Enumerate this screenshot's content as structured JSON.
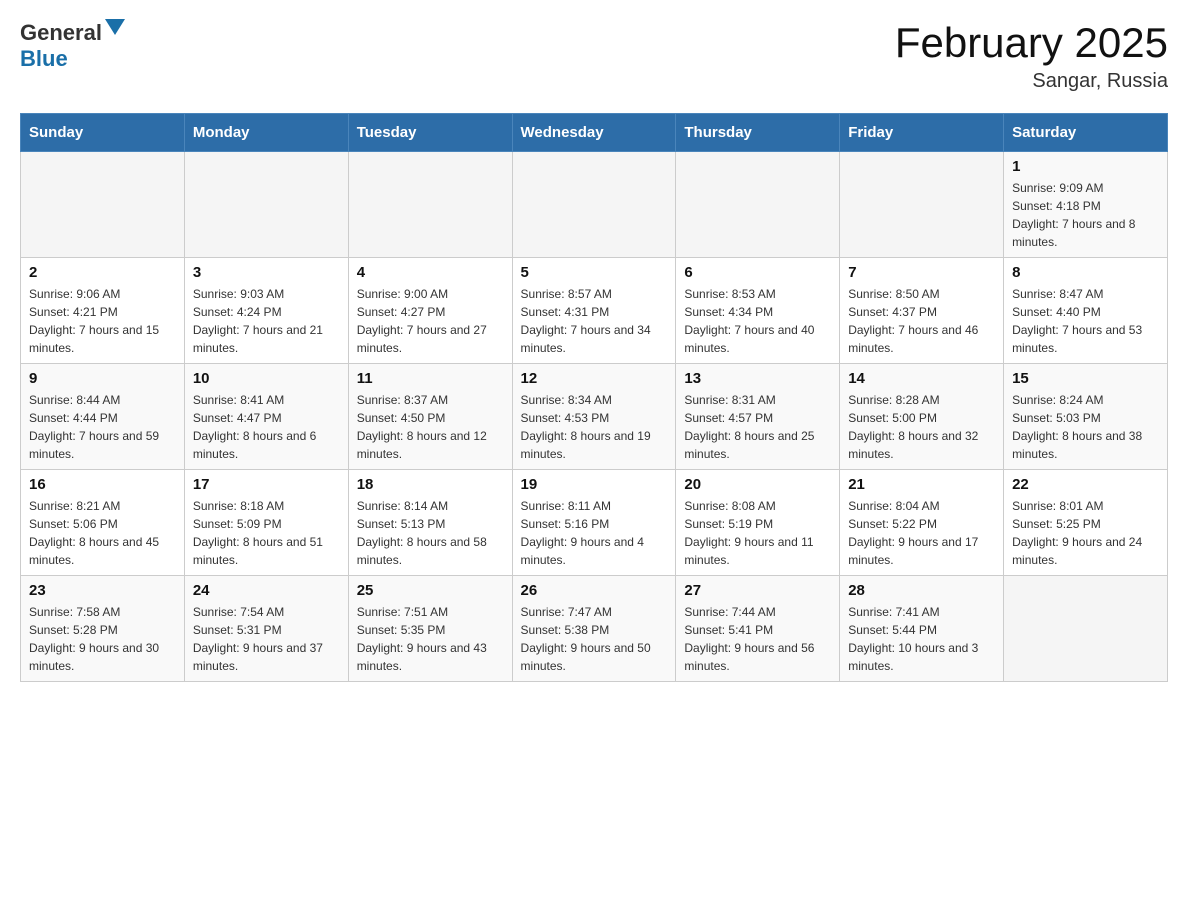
{
  "header": {
    "logo_general": "General",
    "logo_blue": "Blue",
    "title": "February 2025",
    "subtitle": "Sangar, Russia"
  },
  "weekdays": [
    "Sunday",
    "Monday",
    "Tuesday",
    "Wednesday",
    "Thursday",
    "Friday",
    "Saturday"
  ],
  "weeks": [
    [
      {
        "day": "",
        "info": ""
      },
      {
        "day": "",
        "info": ""
      },
      {
        "day": "",
        "info": ""
      },
      {
        "day": "",
        "info": ""
      },
      {
        "day": "",
        "info": ""
      },
      {
        "day": "",
        "info": ""
      },
      {
        "day": "1",
        "info": "Sunrise: 9:09 AM\nSunset: 4:18 PM\nDaylight: 7 hours and 8 minutes."
      }
    ],
    [
      {
        "day": "2",
        "info": "Sunrise: 9:06 AM\nSunset: 4:21 PM\nDaylight: 7 hours and 15 minutes."
      },
      {
        "day": "3",
        "info": "Sunrise: 9:03 AM\nSunset: 4:24 PM\nDaylight: 7 hours and 21 minutes."
      },
      {
        "day": "4",
        "info": "Sunrise: 9:00 AM\nSunset: 4:27 PM\nDaylight: 7 hours and 27 minutes."
      },
      {
        "day": "5",
        "info": "Sunrise: 8:57 AM\nSunset: 4:31 PM\nDaylight: 7 hours and 34 minutes."
      },
      {
        "day": "6",
        "info": "Sunrise: 8:53 AM\nSunset: 4:34 PM\nDaylight: 7 hours and 40 minutes."
      },
      {
        "day": "7",
        "info": "Sunrise: 8:50 AM\nSunset: 4:37 PM\nDaylight: 7 hours and 46 minutes."
      },
      {
        "day": "8",
        "info": "Sunrise: 8:47 AM\nSunset: 4:40 PM\nDaylight: 7 hours and 53 minutes."
      }
    ],
    [
      {
        "day": "9",
        "info": "Sunrise: 8:44 AM\nSunset: 4:44 PM\nDaylight: 7 hours and 59 minutes."
      },
      {
        "day": "10",
        "info": "Sunrise: 8:41 AM\nSunset: 4:47 PM\nDaylight: 8 hours and 6 minutes."
      },
      {
        "day": "11",
        "info": "Sunrise: 8:37 AM\nSunset: 4:50 PM\nDaylight: 8 hours and 12 minutes."
      },
      {
        "day": "12",
        "info": "Sunrise: 8:34 AM\nSunset: 4:53 PM\nDaylight: 8 hours and 19 minutes."
      },
      {
        "day": "13",
        "info": "Sunrise: 8:31 AM\nSunset: 4:57 PM\nDaylight: 8 hours and 25 minutes."
      },
      {
        "day": "14",
        "info": "Sunrise: 8:28 AM\nSunset: 5:00 PM\nDaylight: 8 hours and 32 minutes."
      },
      {
        "day": "15",
        "info": "Sunrise: 8:24 AM\nSunset: 5:03 PM\nDaylight: 8 hours and 38 minutes."
      }
    ],
    [
      {
        "day": "16",
        "info": "Sunrise: 8:21 AM\nSunset: 5:06 PM\nDaylight: 8 hours and 45 minutes."
      },
      {
        "day": "17",
        "info": "Sunrise: 8:18 AM\nSunset: 5:09 PM\nDaylight: 8 hours and 51 minutes."
      },
      {
        "day": "18",
        "info": "Sunrise: 8:14 AM\nSunset: 5:13 PM\nDaylight: 8 hours and 58 minutes."
      },
      {
        "day": "19",
        "info": "Sunrise: 8:11 AM\nSunset: 5:16 PM\nDaylight: 9 hours and 4 minutes."
      },
      {
        "day": "20",
        "info": "Sunrise: 8:08 AM\nSunset: 5:19 PM\nDaylight: 9 hours and 11 minutes."
      },
      {
        "day": "21",
        "info": "Sunrise: 8:04 AM\nSunset: 5:22 PM\nDaylight: 9 hours and 17 minutes."
      },
      {
        "day": "22",
        "info": "Sunrise: 8:01 AM\nSunset: 5:25 PM\nDaylight: 9 hours and 24 minutes."
      }
    ],
    [
      {
        "day": "23",
        "info": "Sunrise: 7:58 AM\nSunset: 5:28 PM\nDaylight: 9 hours and 30 minutes."
      },
      {
        "day": "24",
        "info": "Sunrise: 7:54 AM\nSunset: 5:31 PM\nDaylight: 9 hours and 37 minutes."
      },
      {
        "day": "25",
        "info": "Sunrise: 7:51 AM\nSunset: 5:35 PM\nDaylight: 9 hours and 43 minutes."
      },
      {
        "day": "26",
        "info": "Sunrise: 7:47 AM\nSunset: 5:38 PM\nDaylight: 9 hours and 50 minutes."
      },
      {
        "day": "27",
        "info": "Sunrise: 7:44 AM\nSunset: 5:41 PM\nDaylight: 9 hours and 56 minutes."
      },
      {
        "day": "28",
        "info": "Sunrise: 7:41 AM\nSunset: 5:44 PM\nDaylight: 10 hours and 3 minutes."
      },
      {
        "day": "",
        "info": ""
      }
    ]
  ]
}
